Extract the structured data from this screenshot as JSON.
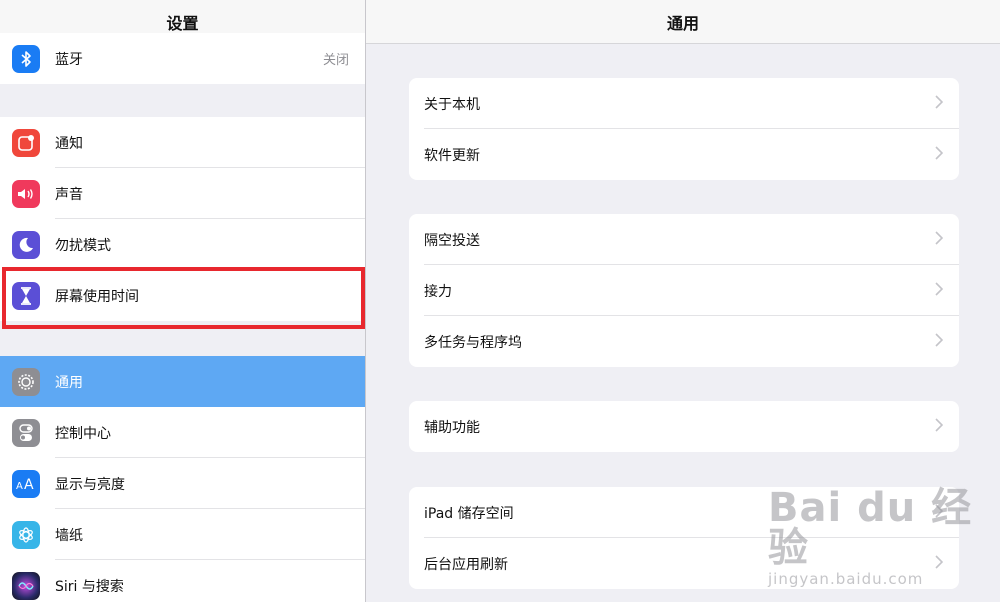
{
  "sidebar": {
    "title": "设置",
    "bluetooth": {
      "label": "蓝牙",
      "value": "关闭",
      "color": "#1a7cf4",
      "icon": "bluetooth-icon"
    },
    "notifications": {
      "label": "通知",
      "color": "#f0473b",
      "icon": "notification-icon"
    },
    "sounds": {
      "label": "声音",
      "color": "#f0395c",
      "icon": "speaker-icon"
    },
    "dnd": {
      "label": "勿扰模式",
      "color": "#5b4fd6",
      "icon": "moon-icon"
    },
    "screen_time": {
      "label": "屏幕使用时间",
      "color": "#5b4fd6",
      "icon": "hourglass-icon"
    },
    "general": {
      "label": "通用",
      "color": "#8e8e93",
      "icon": "gear-icon"
    },
    "control_center": {
      "label": "控制中心",
      "color": "#8e8e93",
      "icon": "toggle-icon"
    },
    "display": {
      "label": "显示与亮度",
      "color": "#1a7cf4",
      "icon": "text-size-icon"
    },
    "wallpaper": {
      "label": "墙纸",
      "color": "#37b5e8",
      "icon": "flower-icon"
    },
    "siri": {
      "label": "Siri 与搜索",
      "color": "#222",
      "icon": "siri-icon"
    }
  },
  "detail": {
    "title": "通用",
    "group1": [
      "关于本机",
      "软件更新"
    ],
    "group2": [
      "隔空投送",
      "接力",
      "多任务与程序坞"
    ],
    "group3": [
      "辅助功能"
    ],
    "group4": [
      "iPad 储存空间",
      "后台应用刷新"
    ]
  },
  "watermark": {
    "line1": "Bai du 经验",
    "line2": "jingyan.baidu.com"
  },
  "colors": {
    "selection": "#5ea8f3",
    "highlight": "#e8282e"
  }
}
